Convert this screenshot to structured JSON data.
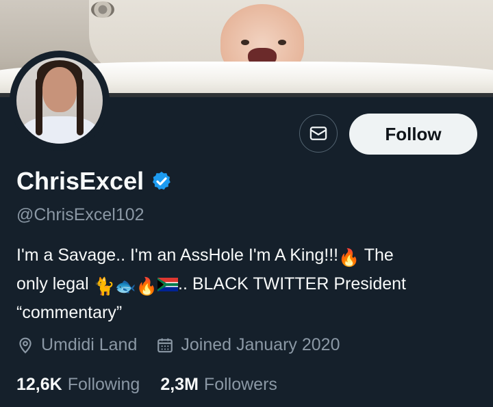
{
  "profile": {
    "name": "ChrisExcel",
    "handle": "@ChrisExcel102",
    "verified": true,
    "bio": {
      "line1_text": "I'm a Savage.. I'm an AssHole I'm A King!!!",
      "line1_tail": "The",
      "line2_prefix": "only legal",
      "line2_suffix": ".. BLACK TWITTER President",
      "line3": "“commentary”",
      "emojis": [
        "fire",
        "cat",
        "fish",
        "fire",
        "south-africa-flag"
      ]
    },
    "location": "Umdidi Land",
    "joined": "Joined January 2020"
  },
  "actions": {
    "follow_label": "Follow",
    "message_icon": "envelope-icon"
  },
  "stats": {
    "following_count": "12,6K",
    "following_label": "Following",
    "followers_count": "2,3M",
    "followers_label": "Followers"
  },
  "colors": {
    "background": "#15202b",
    "text_primary": "#f7f9f9",
    "text_secondary": "#8b98a5",
    "verified_blue": "#1d9bf0",
    "follow_bg": "#eff3f4"
  }
}
